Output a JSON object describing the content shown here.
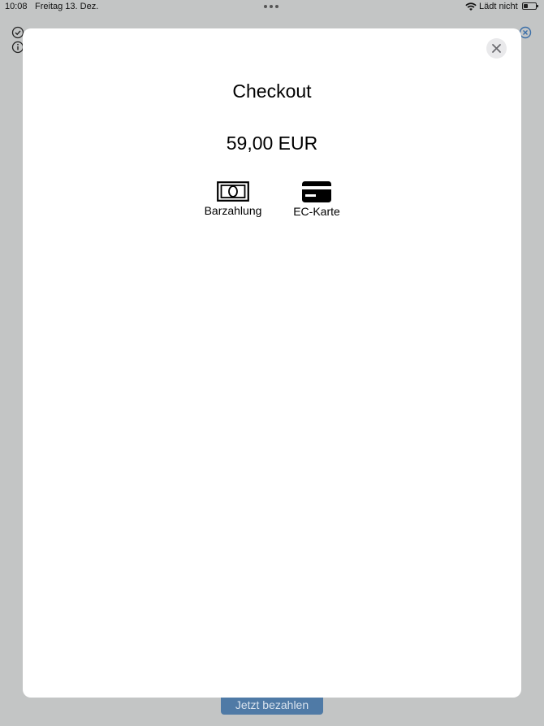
{
  "status_bar": {
    "time": "10:08",
    "date": "Freitag 13. Dez.",
    "charging": "Lädt nicht"
  },
  "background": {
    "pay_button_label": "Jetzt bezahlen"
  },
  "modal": {
    "title": "Checkout",
    "amount": "59,00 EUR",
    "payment_options": [
      {
        "label": "Barzahlung",
        "icon": "cash-icon"
      },
      {
        "label": "EC-Karte",
        "icon": "credit-card-icon"
      }
    ]
  },
  "colors": {
    "overlay": "#c3c5c5",
    "sheet": "#ffffff",
    "accent": "#4f7aa6",
    "close_bg": "#e9e9eb"
  }
}
